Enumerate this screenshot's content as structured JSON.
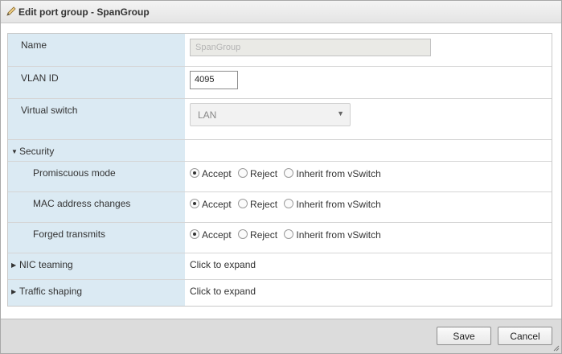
{
  "dialog": {
    "title": "Edit port group - SpanGroup",
    "title_icon": "pencil-icon"
  },
  "fields": {
    "name": {
      "label": "Name",
      "value": "SpanGroup"
    },
    "vlan_id": {
      "label": "VLAN ID",
      "value": "4095"
    },
    "virtual_switch": {
      "label": "Virtual switch",
      "selected": "LAN"
    }
  },
  "security": {
    "label": "Security",
    "expanded": true,
    "options": [
      "Accept",
      "Reject",
      "Inherit from vSwitch"
    ],
    "rows": [
      {
        "label": "Promiscuous mode",
        "selected": "Accept"
      },
      {
        "label": "MAC address changes",
        "selected": "Accept"
      },
      {
        "label": "Forged transmits",
        "selected": "Accept"
      }
    ]
  },
  "nic_teaming": {
    "label": "NIC teaming",
    "value": "Click to expand"
  },
  "traffic_shaping": {
    "label": "Traffic shaping",
    "value": "Click to expand"
  },
  "footer": {
    "save_label": "Save",
    "cancel_label": "Cancel"
  }
}
